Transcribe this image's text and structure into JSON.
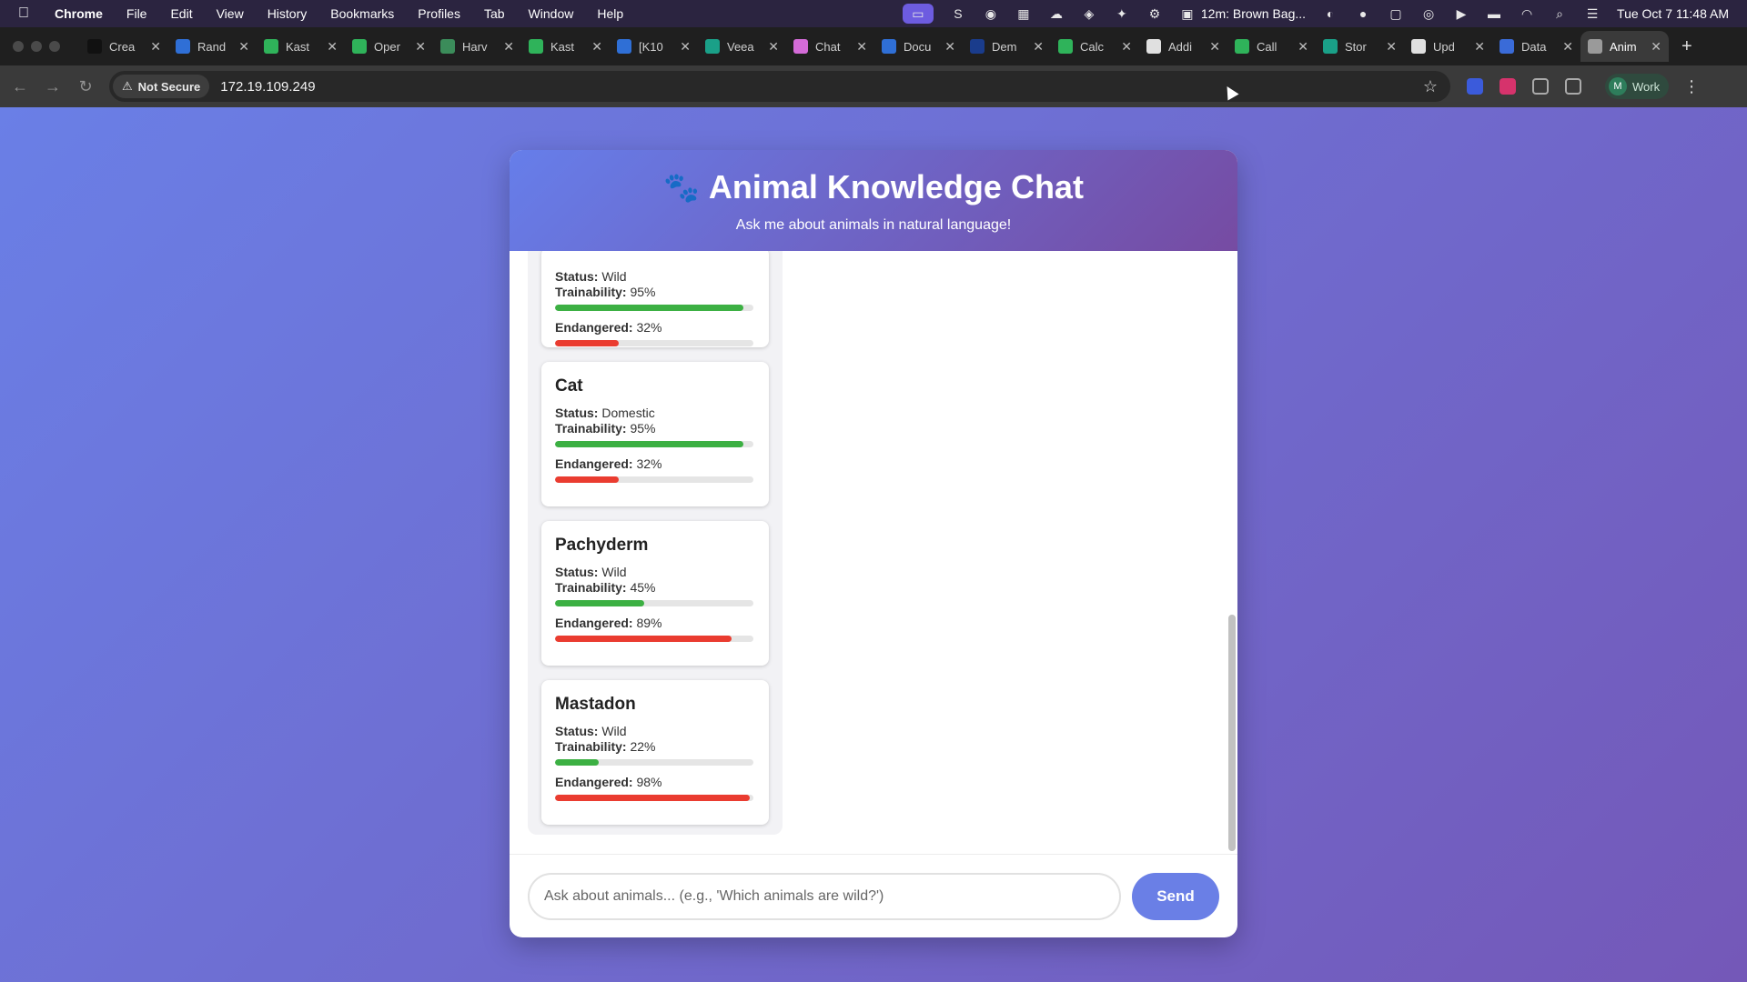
{
  "menubar": {
    "app": "Chrome",
    "items": [
      "File",
      "Edit",
      "View",
      "History",
      "Bookmarks",
      "Profiles",
      "Tab",
      "Window",
      "Help"
    ],
    "meeting": "12m: Brown Bag...",
    "datetime": "Tue Oct 7  11:48 AM"
  },
  "tabs": [
    {
      "title": "Crea",
      "color": "#111111"
    },
    {
      "title": "Rand",
      "color": "#2f6fd6"
    },
    {
      "title": "Kast",
      "color": "#2fb35a"
    },
    {
      "title": "Oper",
      "color": "#2fb35a"
    },
    {
      "title": "Harv",
      "color": "#3b8c5a"
    },
    {
      "title": "Kast",
      "color": "#2fb35a"
    },
    {
      "title": "[K10",
      "color": "#2f6fd6"
    },
    {
      "title": "Veea",
      "color": "#1aa088"
    },
    {
      "title": "Chat",
      "color": "#d46bd8"
    },
    {
      "title": "Docu",
      "color": "#2f6fd6"
    },
    {
      "title": "Dem",
      "color": "#1a3c8c"
    },
    {
      "title": "Calc",
      "color": "#2fb35a"
    },
    {
      "title": "Addi",
      "color": "#e0e0e0"
    },
    {
      "title": "Call",
      "color": "#2fb35a"
    },
    {
      "title": "Stor",
      "color": "#1aa088"
    },
    {
      "title": "Upd",
      "color": "#e0e0e0"
    },
    {
      "title": "Data",
      "color": "#3a6bd8"
    },
    {
      "title": "Anim",
      "color": "#9a9a9a"
    }
  ],
  "toolbar": {
    "security": "Not Secure",
    "url": "172.19.109.249",
    "profile_initial": "M",
    "profile_label": "Work"
  },
  "chat": {
    "title": "Animal Knowledge Chat",
    "subtitle": "Ask me about animals in natural language!",
    "labels": {
      "status": "Status:",
      "trainability": "Trainability:",
      "endangered": "Endangered:"
    },
    "partial_card": {
      "status": "Wild",
      "trainability": "95%",
      "trainability_value": 95,
      "endangered": "32%",
      "endangered_value": 32
    },
    "cards": [
      {
        "name": "Cat",
        "status": "Domestic",
        "trainability": "95%",
        "trainability_value": 95,
        "endangered": "32%",
        "endangered_value": 32
      },
      {
        "name": "Pachyderm",
        "status": "Wild",
        "trainability": "45%",
        "trainability_value": 45,
        "endangered": "89%",
        "endangered_value": 89
      },
      {
        "name": "Mastadon",
        "status": "Wild",
        "trainability": "22%",
        "trainability_value": 22,
        "endangered": "98%",
        "endangered_value": 98
      }
    ],
    "input_placeholder": "Ask about animals... (e.g., 'Which animals are wild?')",
    "send_label": "Send"
  }
}
